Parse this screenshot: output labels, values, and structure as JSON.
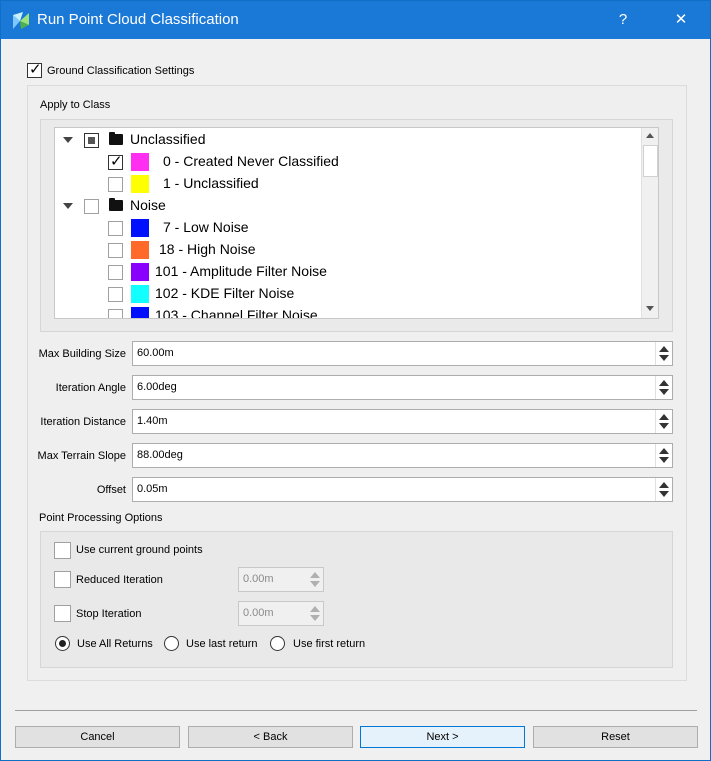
{
  "window": {
    "title": "Run Point Cloud Classification",
    "help_label": "?",
    "close_label": "✕"
  },
  "ground": {
    "label": "Ground Classification Settings",
    "checked": true
  },
  "apply_to_class": {
    "label": "Apply to Class",
    "items": [
      {
        "label": "Unclassified",
        "kind": "group",
        "state": "partial"
      },
      {
        "label": "0 - Created Never Classified",
        "kind": "class",
        "checked": true,
        "color": "#ff2ef0"
      },
      {
        "label": "1 - Unclassified",
        "kind": "class",
        "checked": false,
        "color": "#ffff00"
      },
      {
        "label": "Noise",
        "kind": "group",
        "state": "unchecked"
      },
      {
        "label": "7 - Low Noise",
        "kind": "class",
        "checked": false,
        "color": "#0010ff"
      },
      {
        "label": "18 - High Noise",
        "kind": "class",
        "checked": false,
        "color": "#ff6a2a"
      },
      {
        "label": "101 - Amplitude Filter Noise",
        "kind": "class",
        "checked": false,
        "color": "#8a00ff"
      },
      {
        "label": "102 - KDE Filter Noise",
        "kind": "class",
        "checked": false,
        "color": "#11ffff"
      },
      {
        "label": "103 - Channel Filter Noise",
        "kind": "class",
        "checked": false,
        "color": "#0010ff"
      }
    ]
  },
  "fields": {
    "max_building_size": {
      "label": "Max Building Size",
      "value": "60.00m"
    },
    "iteration_angle": {
      "label": "Iteration Angle",
      "value": "6.00deg"
    },
    "iteration_distance": {
      "label": "Iteration Distance",
      "value": "1.40m"
    },
    "max_terrain_slope": {
      "label": "Max Terrain Slope",
      "value": "88.00deg"
    },
    "offset": {
      "label": "Offset",
      "value": "0.05m"
    }
  },
  "point_processing": {
    "label": "Point Processing Options",
    "use_current_ground": {
      "label": "Use current ground points",
      "checked": false
    },
    "reduced_iteration": {
      "label": "Reduced Iteration",
      "checked": false,
      "value": "0.00m"
    },
    "stop_iteration": {
      "label": "Stop Iteration",
      "checked": false,
      "value": "0.00m"
    },
    "returns": [
      {
        "label": "Use All Returns",
        "selected": true
      },
      {
        "label": "Use last return",
        "selected": false
      },
      {
        "label": "Use first return",
        "selected": false
      }
    ]
  },
  "buttons": {
    "cancel": "Cancel",
    "back": "< Back",
    "next": "Next >",
    "reset": "Reset"
  }
}
